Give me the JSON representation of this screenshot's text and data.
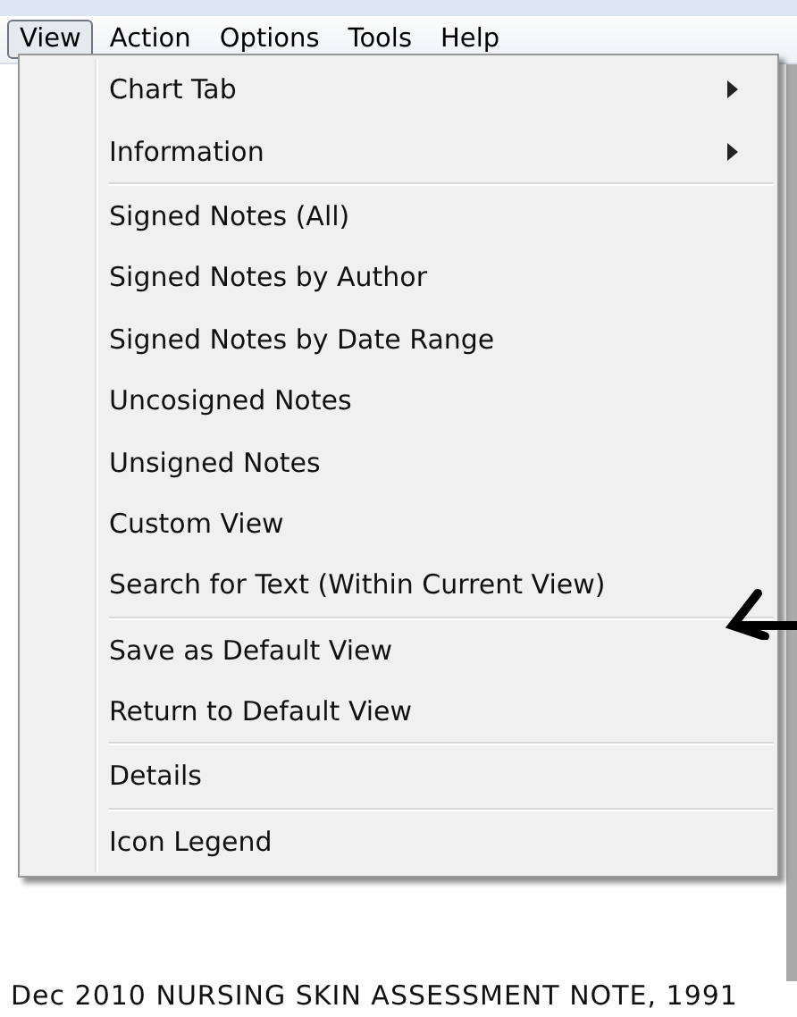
{
  "menubar": [
    {
      "label": "View",
      "selected": true
    },
    {
      "label": "Action",
      "selected": false
    },
    {
      "label": "Options",
      "selected": false
    },
    {
      "label": "Tools",
      "selected": false
    },
    {
      "label": "Help",
      "selected": false
    }
  ],
  "menu": [
    {
      "kind": "item",
      "label": "Chart Tab",
      "submenu": true
    },
    {
      "kind": "item",
      "label": "Information",
      "submenu": true
    },
    {
      "kind": "separator"
    },
    {
      "kind": "item",
      "label": "Signed Notes (All)",
      "submenu": false
    },
    {
      "kind": "item",
      "label": "Signed Notes by Author",
      "submenu": false
    },
    {
      "kind": "item",
      "label": "Signed Notes by Date Range",
      "submenu": false
    },
    {
      "kind": "item",
      "label": "Uncosigned Notes",
      "submenu": false
    },
    {
      "kind": "item",
      "label": "Unsigned Notes",
      "submenu": false
    },
    {
      "kind": "item",
      "label": "Custom View",
      "submenu": false
    },
    {
      "kind": "item",
      "label": "Search for Text (Within Current View)",
      "submenu": false
    },
    {
      "kind": "separator"
    },
    {
      "kind": "item",
      "label": "Save as Default View",
      "submenu": false
    },
    {
      "kind": "item",
      "label": "Return to Default View",
      "submenu": false
    },
    {
      "kind": "separator"
    },
    {
      "kind": "item",
      "label": "Details",
      "submenu": false
    },
    {
      "kind": "separator"
    },
    {
      "kind": "item",
      "label": "Icon Legend",
      "submenu": false
    }
  ],
  "background_row": {
    "text": "Dec 2010 NURSING SKIN ASSESSMENT NOTE, 1991"
  }
}
